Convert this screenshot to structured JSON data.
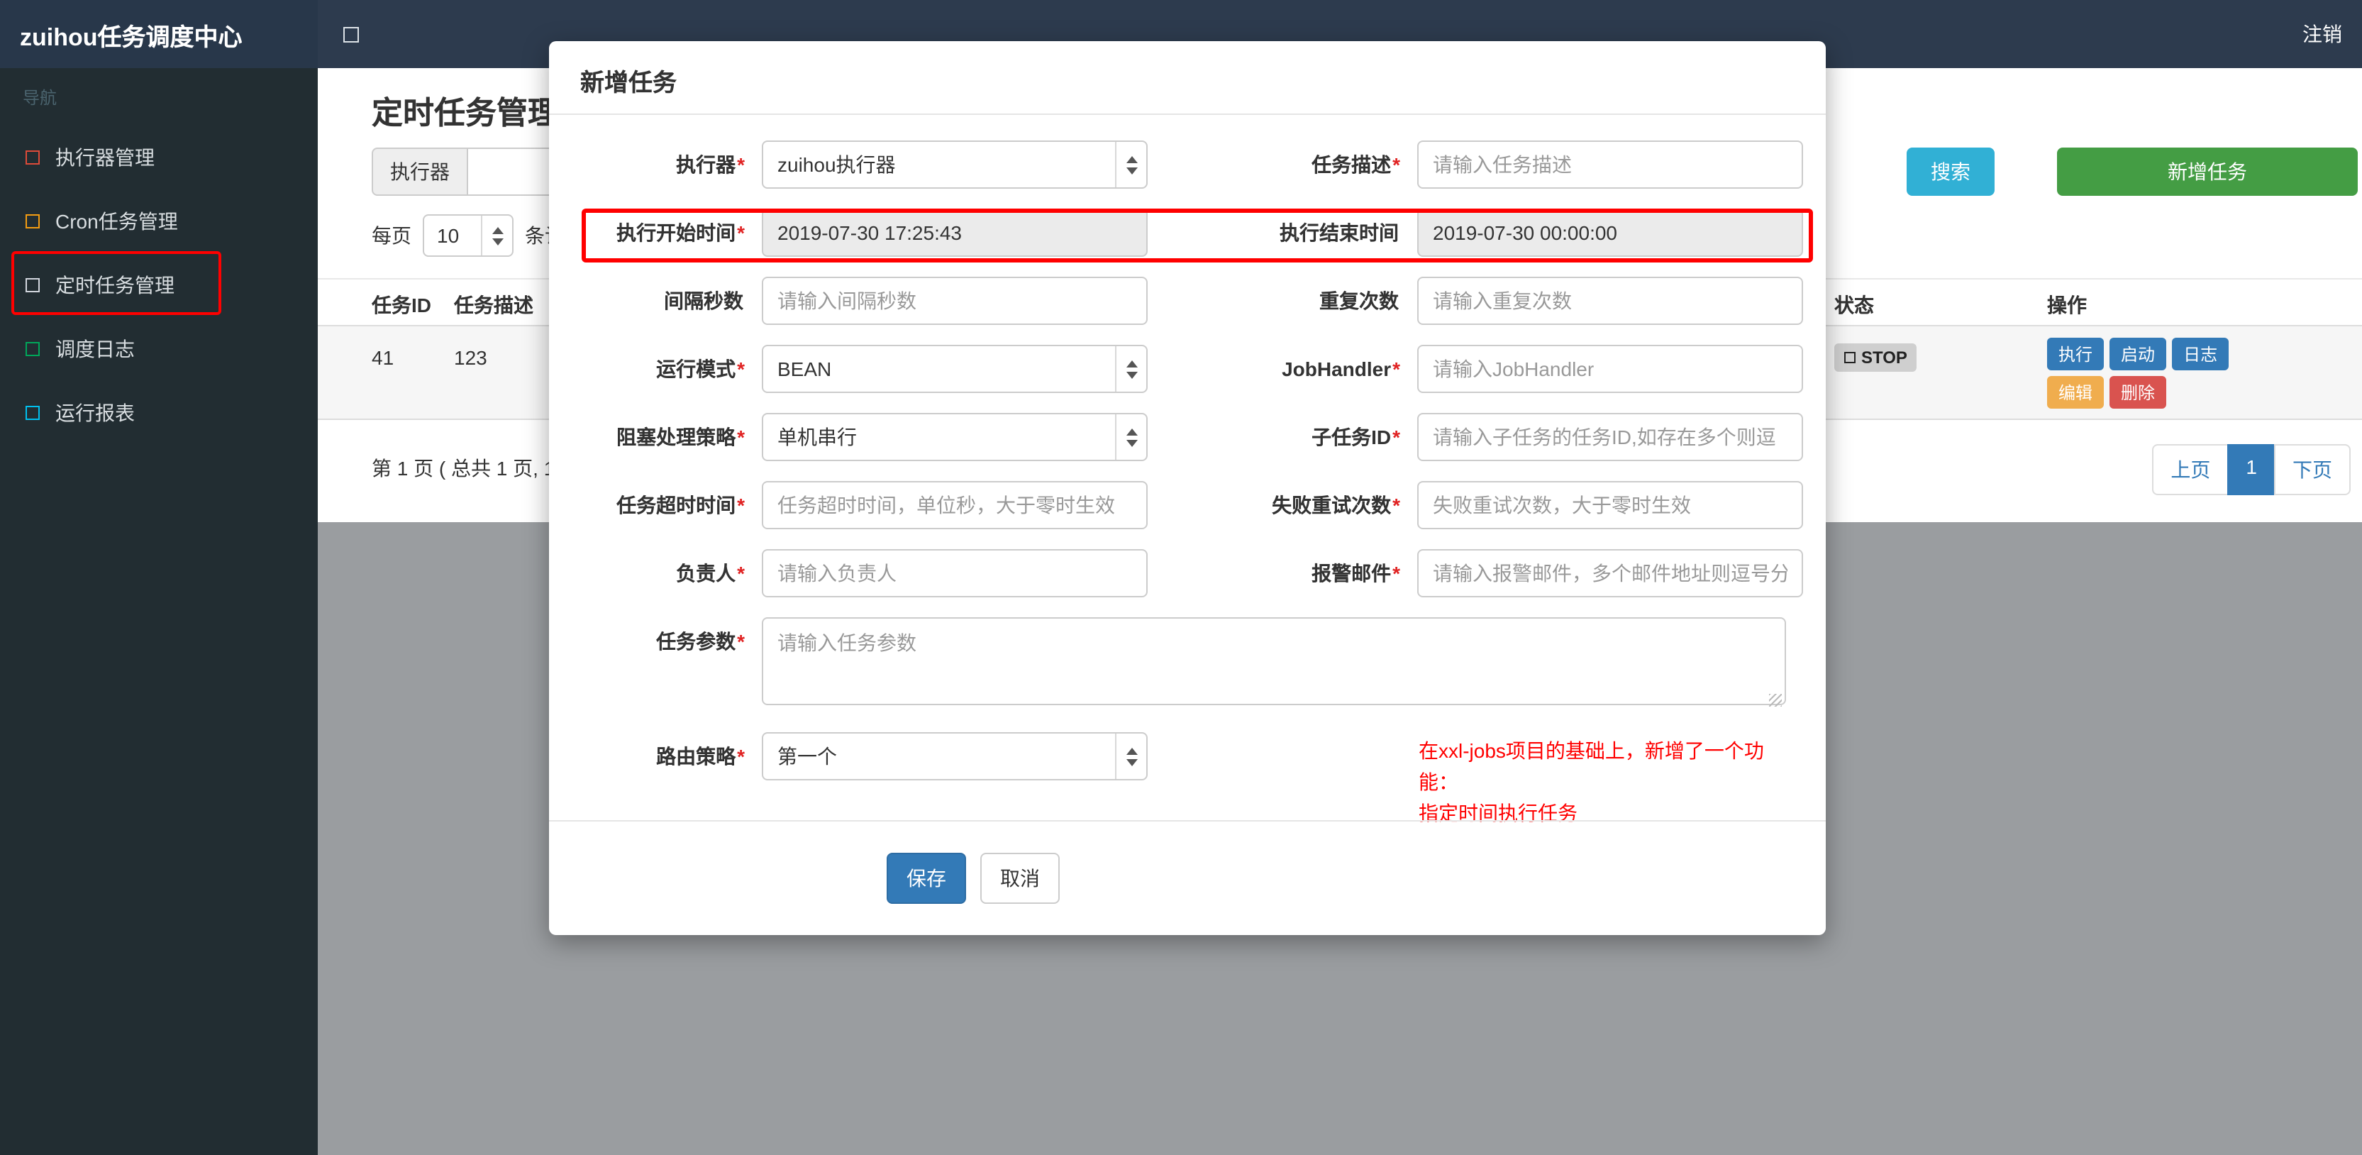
{
  "colors": {
    "navbar_bg": "#2d3b4e",
    "sidebar_bg": "#222d32",
    "primary": "#337ab7",
    "info": "#31b0d5",
    "success": "#449d44",
    "warning": "#f0ad4e",
    "danger": "#d9534f",
    "annotation": "#ff0000"
  },
  "navbar": {
    "brand": "zuihou任务调度中心",
    "logout": "注销"
  },
  "sidebar": {
    "section_label": "导航",
    "items": [
      {
        "label": "执行器管理",
        "icon": "square-icon",
        "icon_color": "#dd4b39"
      },
      {
        "label": "Cron任务管理",
        "icon": "square-icon",
        "icon_color": "#f39c12"
      },
      {
        "label": "定时任务管理",
        "icon": "square-icon",
        "icon_color": "#d2d6de",
        "active": true
      },
      {
        "label": "调度日志",
        "icon": "square-icon",
        "icon_color": "#00a65a"
      },
      {
        "label": "运行报表",
        "icon": "square-icon",
        "icon_color": "#00c0ef"
      }
    ]
  },
  "page": {
    "title": "定时任务管理",
    "filter_addon": "执行器",
    "search_button": "搜索",
    "add_button": "新增任务",
    "perpage": {
      "prefix": "每页",
      "value": "10",
      "suffix": "条记"
    },
    "table": {
      "headers": [
        "任务ID",
        "任务描述",
        "状态",
        "操作"
      ],
      "row": {
        "id": "41",
        "desc": "123",
        "status": "STOP",
        "actions": [
          "执行",
          "启动",
          "日志",
          "编辑",
          "删除"
        ]
      }
    },
    "pagination": {
      "summary": "第 1 页 ( 总共 1 页, 1",
      "prev": "上页",
      "current": "1",
      "next": "下页"
    }
  },
  "modal": {
    "title": "新增任务",
    "rows": [
      {
        "left": {
          "label": "执行器",
          "star": "*",
          "type": "select",
          "value": "zuihou执行器"
        },
        "right": {
          "label": "任务描述",
          "star": "*",
          "type": "input",
          "placeholder": "请输入任务描述"
        }
      },
      {
        "left": {
          "label": "执行开始时间",
          "star": "*",
          "type": "readonly",
          "value": "2019-07-30 17:25:43"
        },
        "right": {
          "label": "执行结束时间",
          "star": "",
          "type": "readonly",
          "value": "2019-07-30 00:00:00"
        }
      },
      {
        "left": {
          "label": "间隔秒数",
          "star": "",
          "type": "input",
          "placeholder": "请输入间隔秒数"
        },
        "right": {
          "label": "重复次数",
          "star": "",
          "type": "input",
          "placeholder": "请输入重复次数"
        }
      },
      {
        "left": {
          "label": "运行模式",
          "star": "*",
          "type": "select",
          "value": "BEAN"
        },
        "right": {
          "label": "JobHandler",
          "star": "*",
          "type": "input",
          "placeholder": "请输入JobHandler"
        }
      },
      {
        "left": {
          "label": "阻塞处理策略",
          "star": "*",
          "type": "select",
          "value": "单机串行"
        },
        "right": {
          "label": "子任务ID",
          "star": "*",
          "type": "input",
          "placeholder": "请输入子任务的任务ID,如存在多个则逗"
        }
      },
      {
        "left": {
          "label": "任务超时时间",
          "star": "*",
          "type": "input",
          "placeholder": "任务超时时间，单位秒，大于零时生效"
        },
        "right": {
          "label": "失败重试次数",
          "star": "*",
          "type": "input",
          "placeholder": "失败重试次数，大于零时生效"
        }
      },
      {
        "left": {
          "label": "负责人",
          "star": "*",
          "type": "input",
          "placeholder": "请输入负责人"
        },
        "right": {
          "label": "报警邮件",
          "star": "*",
          "type": "input",
          "placeholder": "请输入报警邮件，多个邮件地址则逗号分"
        }
      }
    ],
    "param_row": {
      "label": "任务参数",
      "star": "*",
      "placeholder": "请输入任务参数"
    },
    "route_row": {
      "label": "路由策略",
      "star": "*",
      "type": "select",
      "value": "第一个"
    },
    "note": {
      "line1": "在xxl-jobs项目的基础上，新增了一个功能：",
      "line2": "指定时间执行任务"
    },
    "save": "保存",
    "cancel": "取消"
  }
}
